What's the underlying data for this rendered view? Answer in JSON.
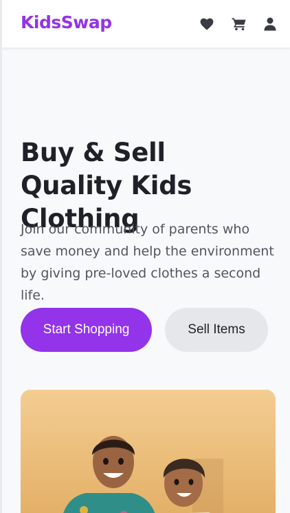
{
  "header": {
    "brand": "KidsSwap",
    "icons": [
      "heart-icon",
      "cart-icon",
      "user-icon"
    ]
  },
  "hero": {
    "title": "Buy & Sell Quality Kids Clothing",
    "subtitle": "Join our community of parents who save money and help the environment by giving pre-loved clothes a second life.",
    "primary_button": "Start Shopping",
    "secondary_button": "Sell Items"
  },
  "colors": {
    "brand": "#9333ea",
    "page_background": "#f8f9fb",
    "secondary_button": "#e6e7eb",
    "text": "#1f2128",
    "muted_text": "#52555f"
  }
}
